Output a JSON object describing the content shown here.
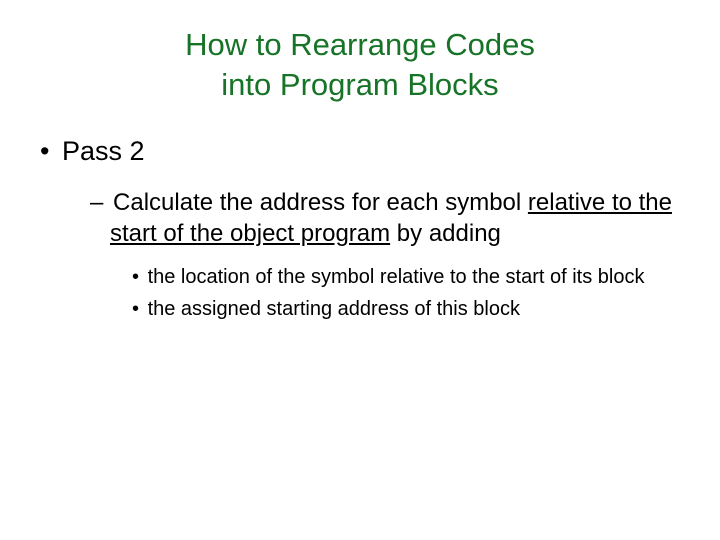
{
  "title_line1": "How to Rearrange Codes",
  "title_line2": "into Program Blocks",
  "bullet1": "Pass 2",
  "sub1_dash": "–",
  "sub1_pre": " Calculate the address for each symbol ",
  "sub1_underlined": "relative to the start of the object program",
  "sub1_post": " by adding",
  "subsub1": "the location of the symbol relative to the start of its block",
  "subsub2": "the assigned starting address of this block"
}
